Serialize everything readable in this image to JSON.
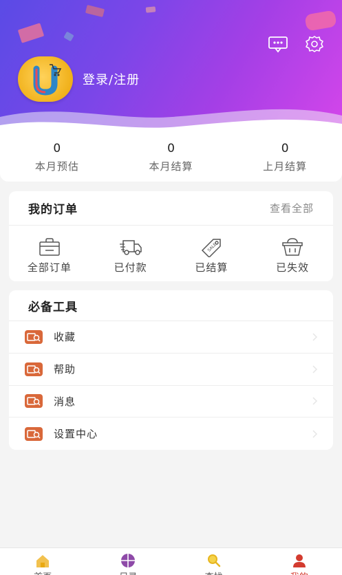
{
  "header": {
    "login_label": "登录/注册"
  },
  "stats": [
    {
      "value": "0",
      "label": "本月预估"
    },
    {
      "value": "0",
      "label": "本月结算"
    },
    {
      "value": "0",
      "label": "上月结算"
    }
  ],
  "orders": {
    "title": "我的订单",
    "view_all": "查看全部",
    "items": [
      {
        "label": "全部订单",
        "icon": "shopping-bag-icon"
      },
      {
        "label": "已付款",
        "icon": "delivery-truck-icon"
      },
      {
        "label": "已结算",
        "icon": "sale-tag-icon"
      },
      {
        "label": "已失效",
        "icon": "basket-icon"
      }
    ]
  },
  "tools": {
    "title": "必备工具",
    "items": [
      {
        "label": "收藏"
      },
      {
        "label": "帮助"
      },
      {
        "label": "消息"
      },
      {
        "label": "设置中心"
      }
    ]
  },
  "tabbar": {
    "items": [
      {
        "label": "首页",
        "icon": "home-icon"
      },
      {
        "label": "目录",
        "icon": "catalog-icon"
      },
      {
        "label": "查找",
        "icon": "search-icon"
      },
      {
        "label": "我的",
        "icon": "user-icon"
      }
    ],
    "active_index": 3
  },
  "colors": {
    "accent": "#d33b2f",
    "tool_icon": "#d9683a",
    "gradient_start": "#5a4be6",
    "gradient_end": "#d546ea"
  }
}
